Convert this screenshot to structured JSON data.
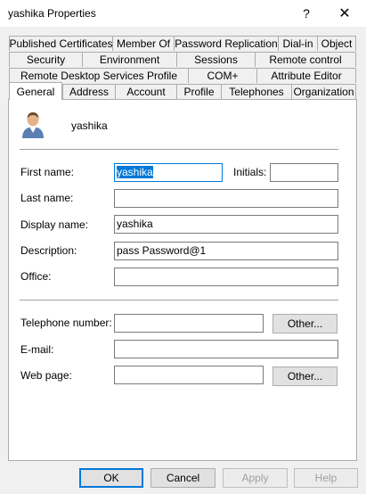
{
  "window": {
    "title": "yashika Properties",
    "help_glyph": "?",
    "close_glyph": "✕"
  },
  "tabs": {
    "row1": [
      "Published Certificates",
      "Member Of",
      "Password Replication",
      "Dial-in",
      "Object"
    ],
    "row2": [
      "Security",
      "Environment",
      "Sessions",
      "Remote control"
    ],
    "row3": [
      "Remote Desktop Services Profile",
      "COM+",
      "Attribute Editor"
    ],
    "row4": [
      "General",
      "Address",
      "Account",
      "Profile",
      "Telephones",
      "Organization"
    ],
    "active": "General"
  },
  "general": {
    "username": "yashika",
    "first_name_label": "First name:",
    "first_name_value": "yashika",
    "initials_label": "Initials:",
    "initials_value": "",
    "last_name_label": "Last name:",
    "last_name_value": "",
    "display_name_label": "Display name:",
    "display_name_value": "yashika",
    "description_label": "Description:",
    "description_value": "pass Password@1",
    "office_label": "Office:",
    "office_value": "",
    "telephone_label": "Telephone number:",
    "telephone_value": "",
    "email_label": "E-mail:",
    "email_value": "",
    "webpage_label": "Web page:",
    "webpage_value": "",
    "other_label": "Other..."
  },
  "buttons": {
    "ok": "OK",
    "cancel": "Cancel",
    "apply": "Apply",
    "help": "Help"
  },
  "colors": {
    "accent": "#0078d7"
  }
}
